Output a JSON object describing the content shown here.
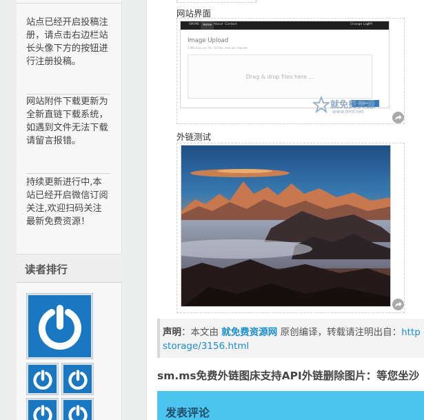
{
  "sidebar": {
    "notices": [
      "站点已经开启投稿注册，请点击右边栏站长头像下方的按钮进行注册投稿。",
      "网站附件下载更新为全新直链下载系统，如遇到文件无法下载请留言报错。",
      "持续更新进行中,本站已经开启微信订阅关注,欢迎扫码关注最新免费资源！"
    ],
    "readers_title": "读者排行"
  },
  "article": {
    "caption_site": "网站界面",
    "caption_link": "外链测试",
    "screenshot": {
      "brand": "SM.MS",
      "nav": [
        "Home",
        "About",
        "Contact"
      ],
      "nav_right": [
        "Change Log",
        "API"
      ],
      "title": "Image Upload",
      "subtitle": "5 MB max per file. 10 files max per request.",
      "drop_text": "Drag & drop files here ...",
      "button": "Browse ..."
    },
    "watermark": {
      "text": "就免费资源",
      "url": "www.9mf.net"
    },
    "statement": {
      "label": "声明",
      "colon": "：本文由 ",
      "site": "就免费资源网",
      "rest": " 原创编译，转载请注明出自：",
      "url_start": "http",
      "url_line2": "storage/3156.html"
    },
    "related_title": "sm.ms免费外链图床支持API外链删除图片：等您坐沙",
    "comment_title": "发表评论"
  },
  "colors": {
    "accent": "#1a8dce",
    "comment_bar": "#4dc4f0",
    "avatar_blue": "#1a77c2"
  }
}
